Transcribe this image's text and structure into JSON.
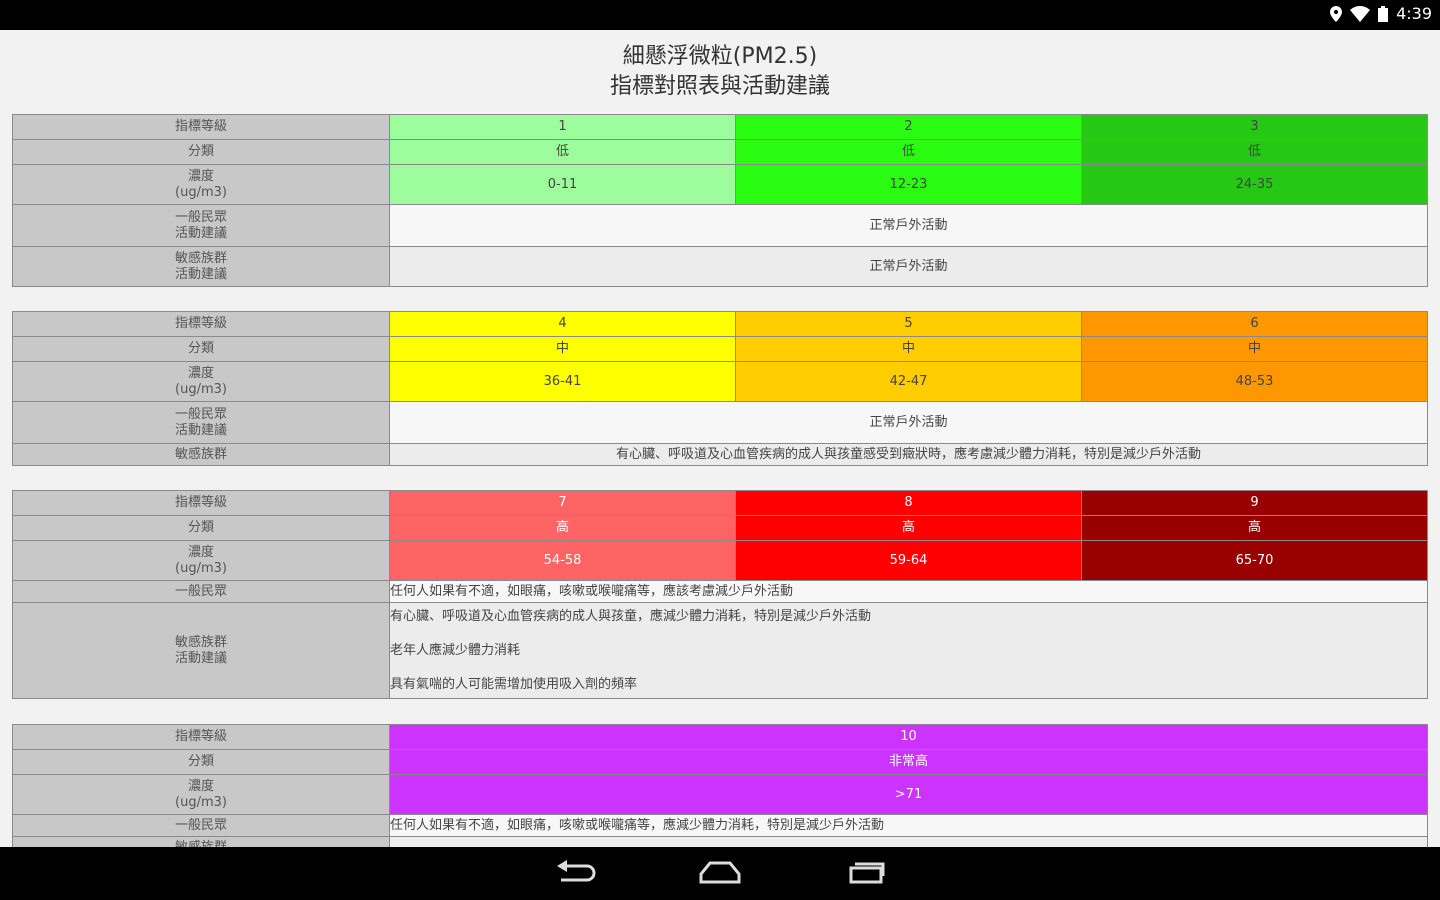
{
  "status_bar": {
    "time": "4:39"
  },
  "title": {
    "line1": "細懸浮微粒(PM2.5)",
    "line2": "指標對照表與活動建議"
  },
  "labels": {
    "index_level": "指標等級",
    "category": "分類",
    "concentration_1": "濃度",
    "concentration_2": "(ug/m3)",
    "general_1": "一般民眾",
    "general_2": "活動建議",
    "sensitive_1": "敏感族群",
    "sensitive_2": "活動建議"
  },
  "section1": {
    "levels": [
      "1",
      "2",
      "3"
    ],
    "categories": [
      "低",
      "低",
      "低"
    ],
    "concentrations": [
      "0-11",
      "12-23",
      "24-35"
    ],
    "general_advice": "正常戶外活動",
    "sensitive_advice": "正常戶外活動"
  },
  "section2": {
    "levels": [
      "4",
      "5",
      "6"
    ],
    "categories": [
      "中",
      "中",
      "中"
    ],
    "concentrations": [
      "36-41",
      "42-47",
      "48-53"
    ],
    "general_advice": "正常戶外活動",
    "sensitive_advice": "有心臟、呼吸道及心血管疾病的成人與孩童感受到癥狀時，應考慮減少體力消耗，特別是減少戶外活動"
  },
  "section3": {
    "levels": [
      "7",
      "8",
      "9"
    ],
    "categories": [
      "高",
      "高",
      "高"
    ],
    "concentrations": [
      "54-58",
      "59-64",
      "65-70"
    ],
    "general_advice": "任何人如果有不適，如眼痛，咳嗽或喉嚨痛等，應該考慮減少戶外活動",
    "sensitive_advice": [
      "有心臟、呼吸道及心血管疾病的成人與孩童，應減少體力消耗，特別是減少戶外活動",
      "老年人應減少體力消耗",
      "具有氣喘的人可能需增加使用吸入劑的頻率"
    ]
  },
  "section4": {
    "level": "10",
    "category": "非常高",
    "concentration": ">71",
    "general_advice": "任何人如果有不適，如眼痛，咳嗽或喉嚨痛等，應減少體力消耗，特別是減少戶外活動"
  },
  "colors": {
    "level1": "#9dfc9c",
    "level2": "#2afc12",
    "level3": "#27c716",
    "level4": "#ffff00",
    "level5": "#ffcd00",
    "level6": "#ff9800",
    "level7": "#ff6464",
    "level8": "#ff0000",
    "level9": "#990000",
    "level10": "#cc33ff"
  },
  "icons": [
    "location-icon",
    "wifi-icon",
    "battery-icon",
    "back-icon",
    "home-icon",
    "recents-icon"
  ]
}
